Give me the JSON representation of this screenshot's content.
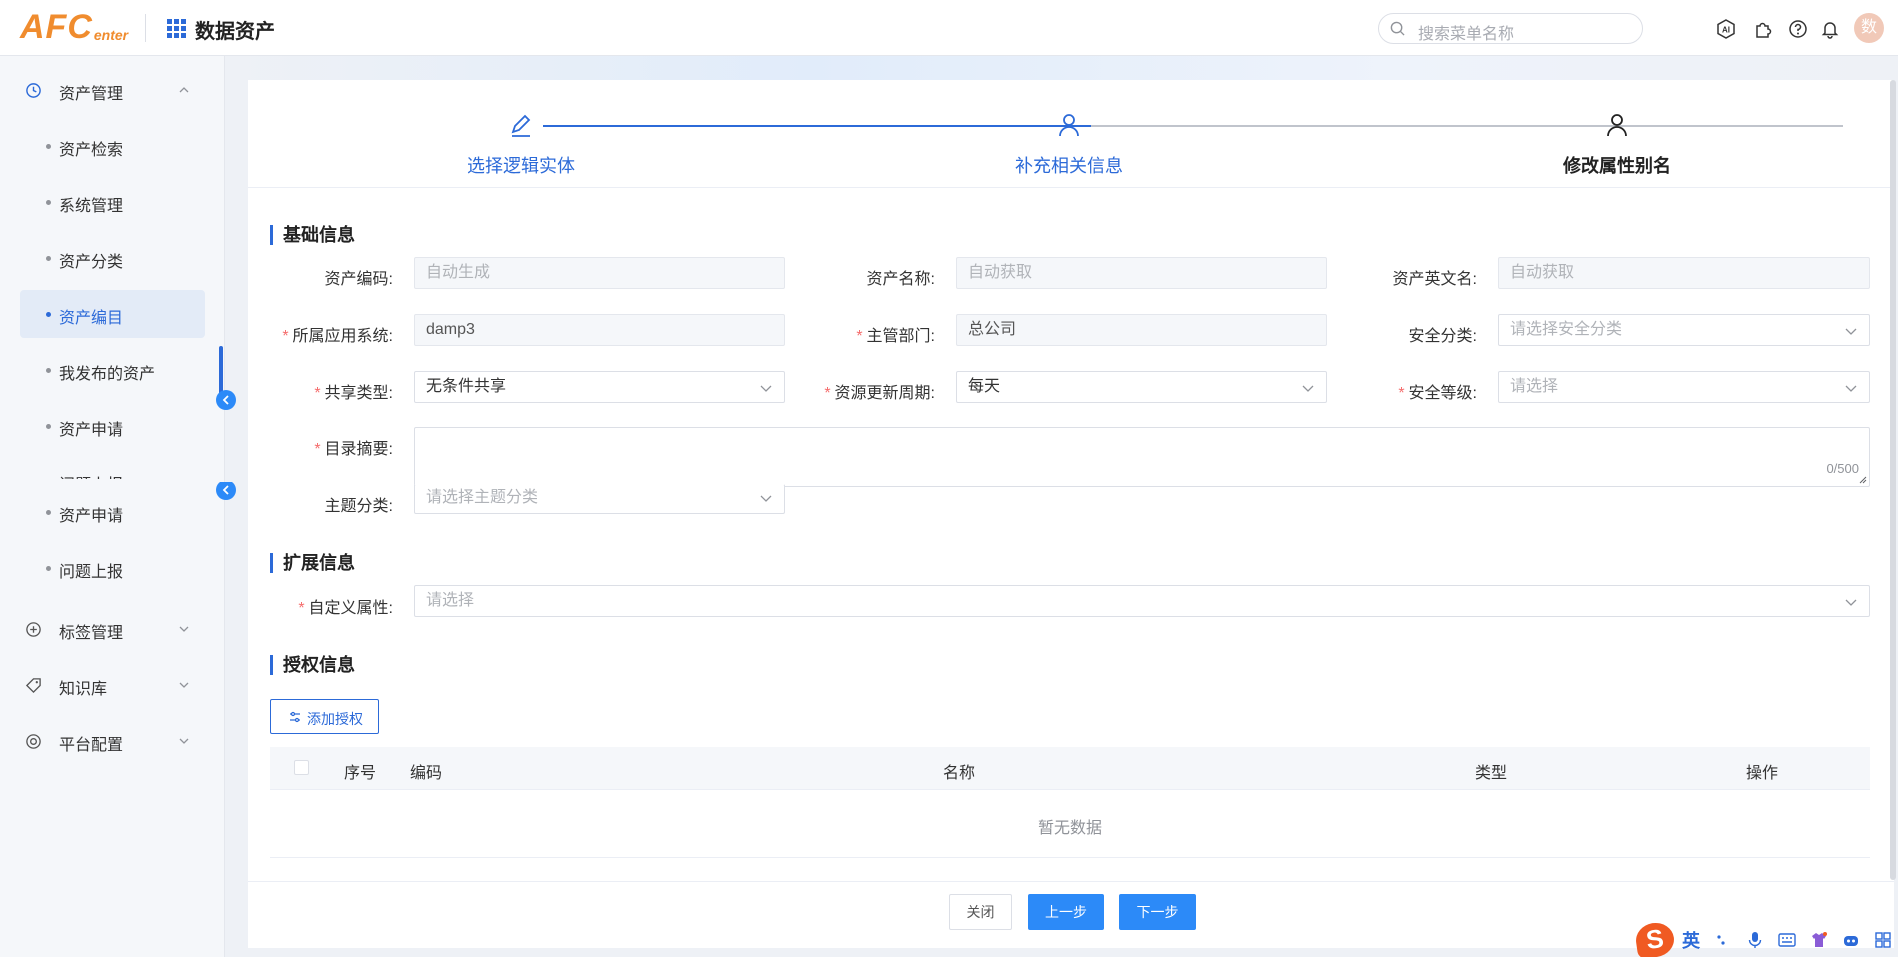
{
  "header": {
    "logo_big": "AFC",
    "logo_small": "enter",
    "app_title": "数据资产",
    "search_placeholder": "搜索菜单名称",
    "avatar_text": "数"
  },
  "sidebar": {
    "group_asset": "资产管理",
    "items": [
      "资产检索",
      "系统管理",
      "资产分类",
      "资产编目",
      "我发布的资产",
      "资产申请",
      "问题上报",
      "资产申请",
      "问题上报"
    ],
    "group_tag": "标签管理",
    "group_kb": "知识库",
    "group_platform": "平台配置"
  },
  "steps": [
    {
      "label": "选择逻辑实体"
    },
    {
      "label": "补充相关信息"
    },
    {
      "label": "修改属性别名"
    }
  ],
  "sections": {
    "basic": "基础信息",
    "ext": "扩展信息",
    "auth": "授权信息"
  },
  "form": {
    "asset_code_label": "资产编码:",
    "asset_code_ph": "自动生成",
    "asset_name_label": "资产名称:",
    "asset_name_ph": "自动获取",
    "asset_en_label": "资产英文名:",
    "asset_en_ph": "自动获取",
    "app_system_label": "所属应用系统:",
    "app_system_value": "damp3",
    "dept_label": "主管部门:",
    "dept_value": "总公司",
    "sec_class_label": "安全分类:",
    "sec_class_ph": "请选择安全分类",
    "share_type_label": "共享类型:",
    "share_type_value": "无条件共享",
    "update_cycle_label": "资源更新周期:",
    "update_cycle_value": "每天",
    "sec_level_label": "安全等级:",
    "sec_level_ph": "请选择",
    "summary_label": "目录摘要:",
    "summary_count": "0/500",
    "topic_label": "主题分类:",
    "topic_ph": "请选择主题分类",
    "custom_attr_label": "自定义属性:",
    "custom_attr_ph": "请选择",
    "req": "*"
  },
  "auth": {
    "add_button": "添加授权",
    "columns": [
      "序号",
      "编码",
      "名称",
      "类型",
      "操作"
    ],
    "empty_text": "暂无数据"
  },
  "footer": {
    "close": "关闭",
    "prev": "上一步",
    "next": "下一步"
  },
  "ime": {
    "logo": "S",
    "lang": "英"
  },
  "colors": {
    "primary": "#2c6ad8",
    "button": "#2c8af8",
    "logo": "#f08c2e",
    "required": "#f56c6c"
  }
}
